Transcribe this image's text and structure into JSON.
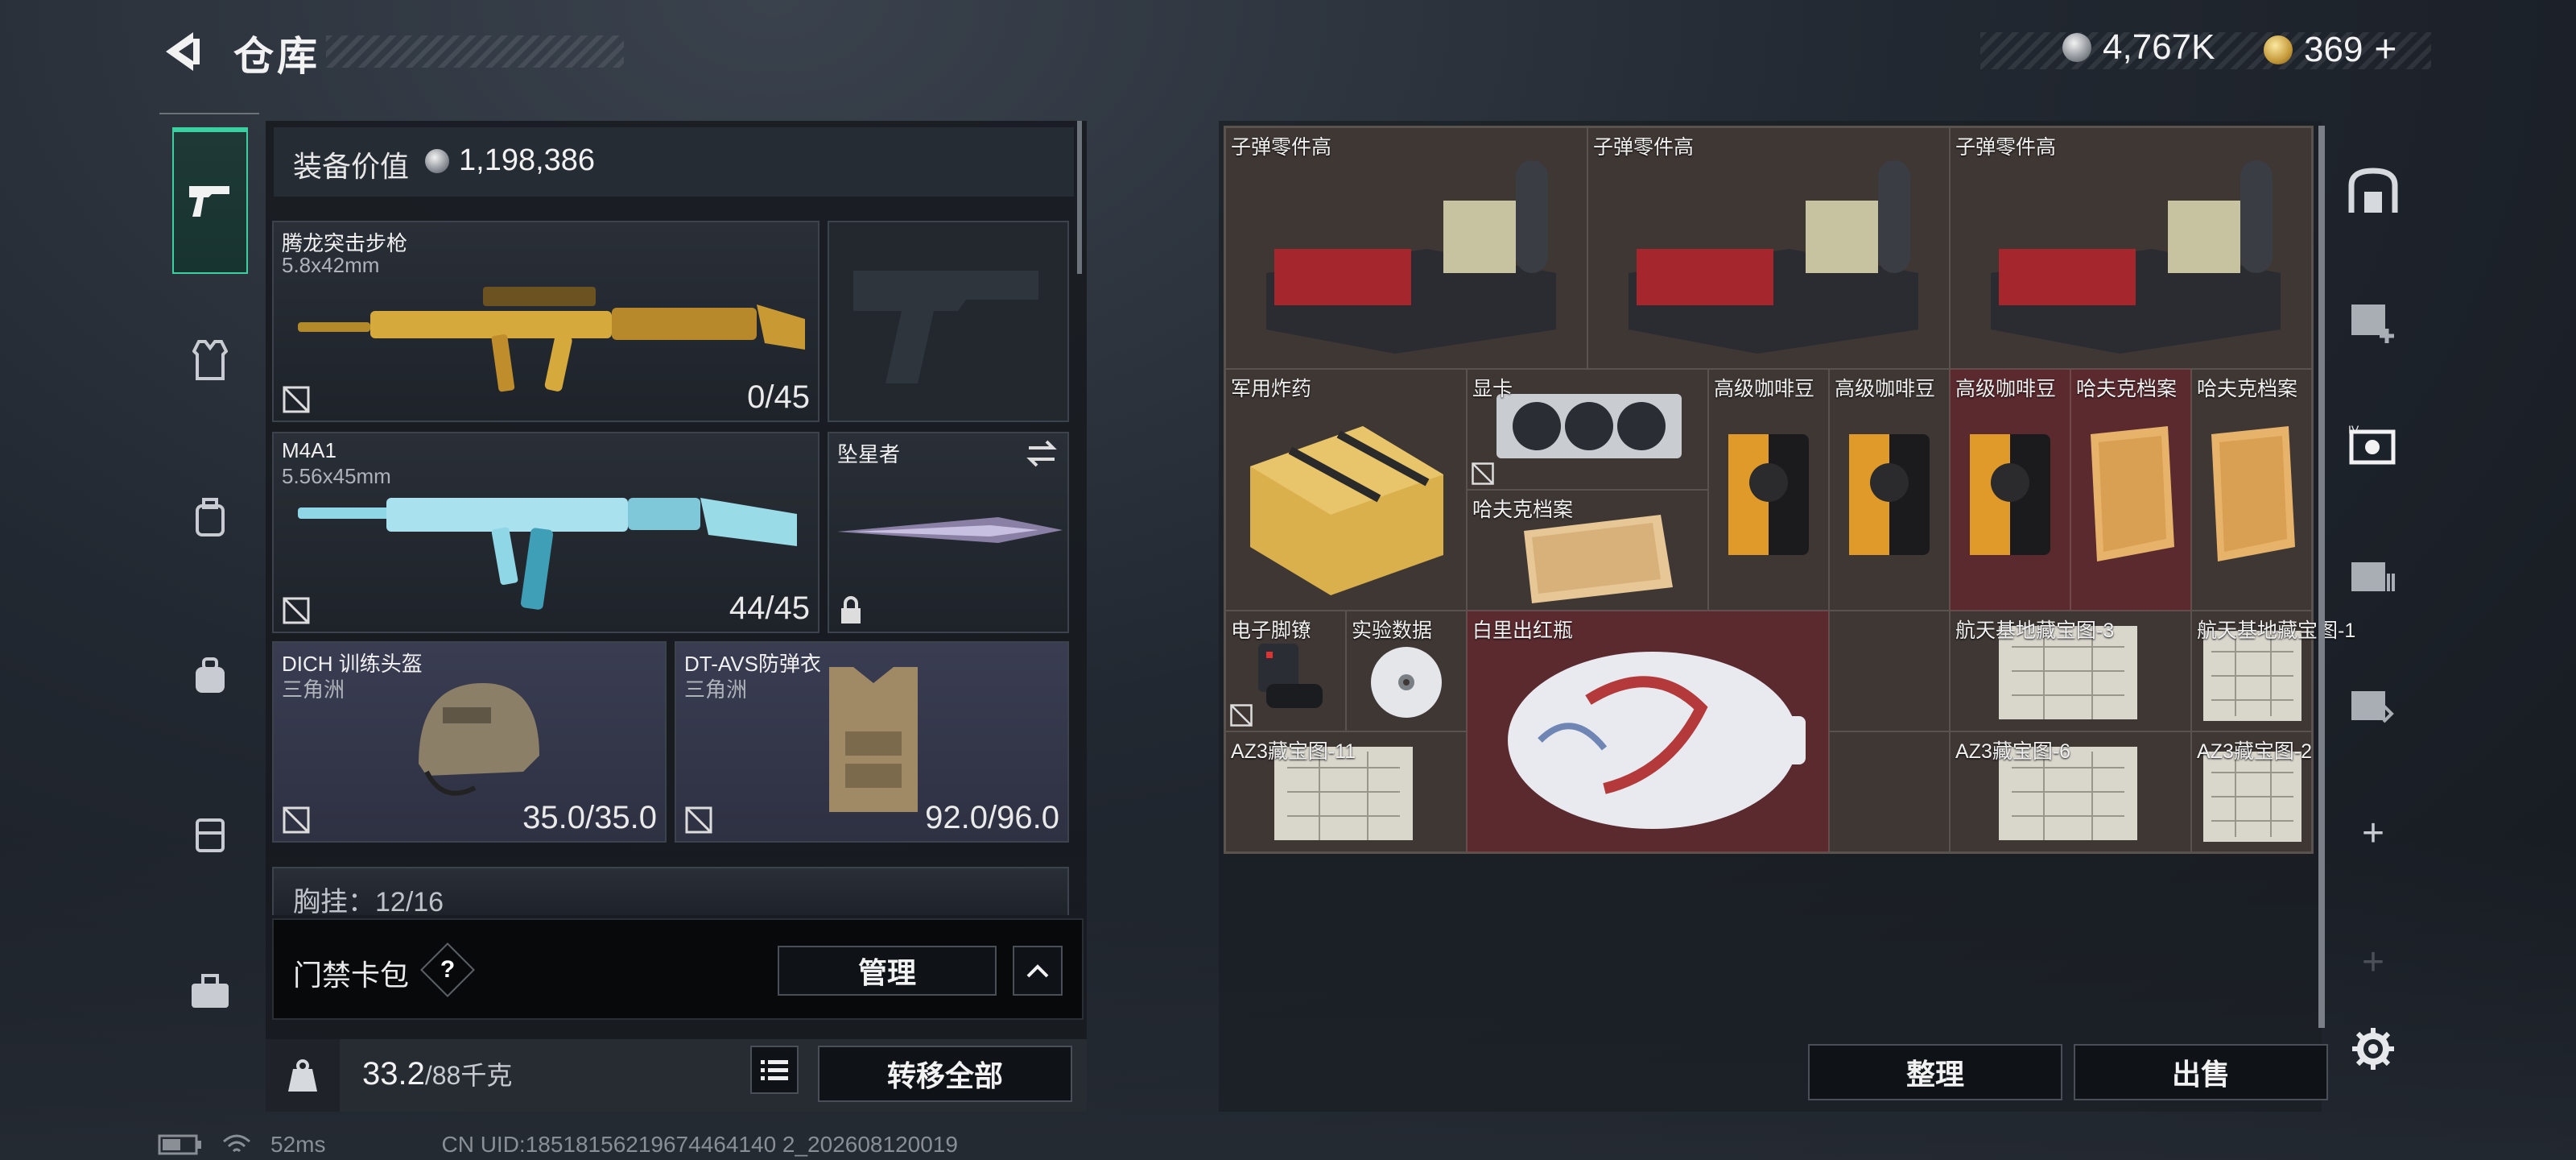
{
  "header": {
    "title": "仓库"
  },
  "currency": {
    "silver": "4,767K",
    "gold": "369",
    "gold_plus": "+"
  },
  "equipment": {
    "value_label": "装备价值",
    "value": "1,198,386",
    "primary1": {
      "name": "腾龙突击步枪",
      "caliber": "5.8x42mm",
      "ammo": "0/45"
    },
    "primary2": {
      "name": "M4A1",
      "caliber": "5.56x45mm",
      "ammo": "44/45"
    },
    "melee": {
      "name": "坠星者"
    },
    "helmet": {
      "name": "DICH 训练头盔",
      "brand": "三角洲",
      "durability": "35.0/35.0"
    },
    "armor": {
      "name": "DT-AVS防弹衣",
      "brand": "三角洲",
      "durability": "92.0/96.0"
    },
    "rig_partial": "胸挂：12/16"
  },
  "cardpack": {
    "label": "门禁卡包",
    "help": "?",
    "manage": "管理"
  },
  "weight": {
    "current": "33.2",
    "max": "/88千克",
    "transfer_all": "转移全部"
  },
  "stash": {
    "items": [
      {
        "name": "子弹零件高"
      },
      {
        "name": "子弹零件高"
      },
      {
        "name": "子弹零件高"
      },
      {
        "name": "军用炸药"
      },
      {
        "name": "显卡"
      },
      {
        "name": "哈夫克档案"
      },
      {
        "name": "高级咖啡豆"
      },
      {
        "name": "高级咖啡豆"
      },
      {
        "name": "高级咖啡豆"
      },
      {
        "name": "哈夫克档案"
      },
      {
        "name": "哈夫克档案"
      },
      {
        "name": "电子脚镣"
      },
      {
        "name": "实验数据"
      },
      {
        "name": "白里出红瓶"
      },
      {
        "name": "航天基地藏宝图-3"
      },
      {
        "name": "航天基地藏宝图-1"
      },
      {
        "name": "AZ3藏宝图-11"
      },
      {
        "name": "AZ3藏宝图-6"
      },
      {
        "name": "AZ3藏宝图-2"
      }
    ],
    "sort_btn": "整理",
    "sell_btn": "出售"
  },
  "status": {
    "ping": "52ms",
    "uid": "CN UID:18518156219674464140 2_202608120019"
  },
  "colors": {
    "accent": "#3ad0a0",
    "grid_bg": "#3e3734",
    "red_cell": "#5a2a2f"
  }
}
